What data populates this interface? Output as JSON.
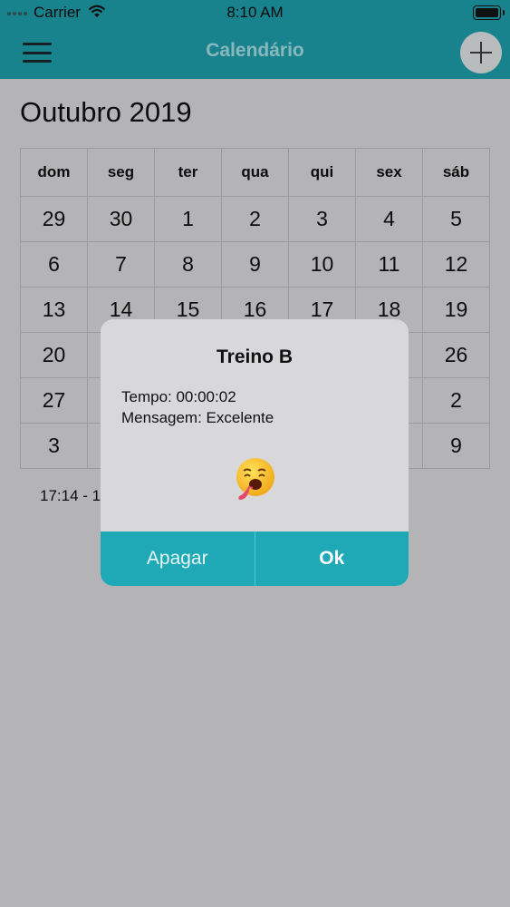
{
  "status_bar": {
    "carrier": "Carrier",
    "time": "8:10 AM"
  },
  "navbar": {
    "title": "Calendário",
    "menu_icon": "hamburger-menu-icon",
    "add_icon": "plus-icon"
  },
  "calendar": {
    "month_title": "Outubro 2019",
    "weekdays": [
      "dom",
      "seg",
      "ter",
      "qua",
      "qui",
      "sex",
      "sáb"
    ],
    "weeks": [
      [
        "29",
        "30",
        "1",
        "2",
        "3",
        "4",
        "5"
      ],
      [
        "6",
        "7",
        "8",
        "9",
        "10",
        "11",
        "12"
      ],
      [
        "13",
        "14",
        "15",
        "16",
        "17",
        "18",
        "19"
      ],
      [
        "20",
        "",
        "",
        "",
        "",
        "",
        "26"
      ],
      [
        "27",
        "",
        "",
        "",
        "",
        "",
        "2"
      ],
      [
        "3",
        "",
        "",
        "",
        "",
        "",
        "9"
      ]
    ],
    "event_text": "17:14 - 1"
  },
  "alert": {
    "title": "Treino B",
    "time_line": "Tempo: 00:00:02",
    "message_line": "Mensagem: Excelente",
    "emoji_icon": "exhausted-face-emoji",
    "cancel_label": "Apagar",
    "ok_label": "Ok"
  },
  "colors": {
    "accent": "#19838d",
    "button": "#1fa9b6",
    "overlay": "#b4b4b6"
  }
}
